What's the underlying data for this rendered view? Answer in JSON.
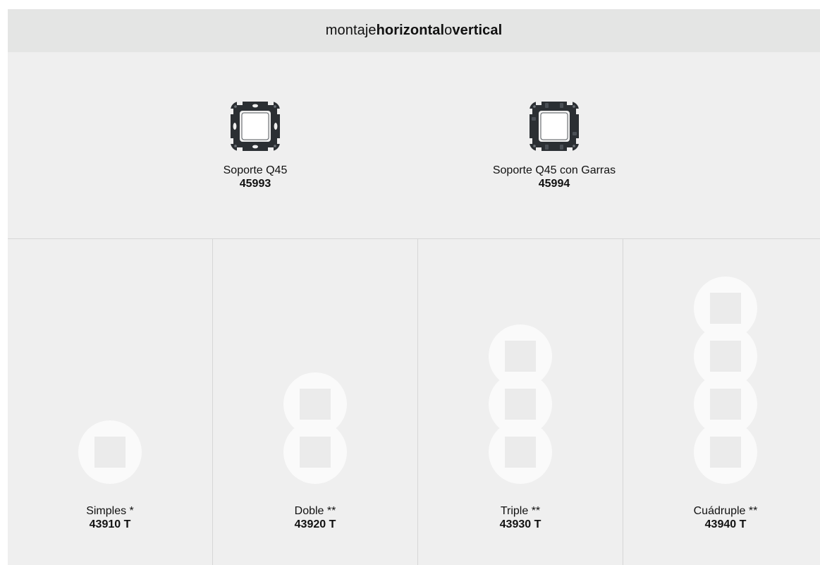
{
  "header": {
    "prefix": "montaje ",
    "bold1": "horizontal",
    "middle": " o ",
    "bold2": "vertical"
  },
  "supports": [
    {
      "name": "Soporte Q45",
      "code": "45993",
      "icon": "support-frame-icon"
    },
    {
      "name": "Soporte Q45 con Garras",
      "code": "45994",
      "icon": "support-frame-claws-icon"
    }
  ],
  "plates": [
    {
      "name": "Simples *",
      "code": "43910 T",
      "modules": 1,
      "icon": "single-plate-icon"
    },
    {
      "name": "Doble **",
      "code": "43920 T",
      "modules": 2,
      "icon": "double-plate-icon"
    },
    {
      "name": "Triple **",
      "code": "43930 T",
      "modules": 3,
      "icon": "triple-plate-icon"
    },
    {
      "name": "Cuádruple **",
      "code": "43940 T",
      "modules": 4,
      "icon": "quadruple-plate-icon"
    }
  ],
  "colors": {
    "header_bg": "#e4e5e4",
    "panel_bg": "#efefef",
    "plate_fill": "#fafafa",
    "divider": "#d6d6d6",
    "support_frame": "#2b2f33"
  }
}
